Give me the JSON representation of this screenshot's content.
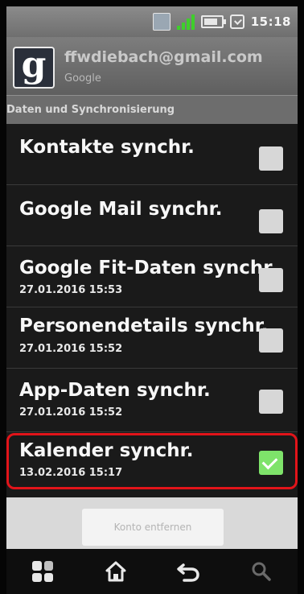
{
  "status_bar": {
    "time": "15:18",
    "icons": [
      "sim-icon",
      "signal-icon",
      "battery-icon",
      "alarm-icon"
    ],
    "signal_color": "#3ecf2b"
  },
  "account": {
    "logo_letter": "g",
    "email": "ffwdiebach@gmail.com",
    "provider": "Google"
  },
  "section_header": "Daten und Synchronisierung",
  "sync_items": [
    {
      "title": "Kontakte synchr.",
      "subtitle": "",
      "checked": false
    },
    {
      "title": "Google Mail synchr.",
      "subtitle": "",
      "checked": false
    },
    {
      "title": "Google Fit-Daten synchr.",
      "subtitle": "27.01.2016 15:53",
      "checked": false
    },
    {
      "title": "Personendetails synchr.",
      "subtitle": "27.01.2016 15:52",
      "checked": false
    },
    {
      "title": "App-Daten synchr.",
      "subtitle": "27.01.2016 15:52",
      "checked": false
    },
    {
      "title": "Kalender synchr.",
      "subtitle": "13.02.2016 15:17",
      "checked": true
    }
  ],
  "highlight_color": "#e2141a",
  "checkbox_checked_color": "#7ee36a",
  "remove_account_label": "Konto entfernen",
  "nav_bar": {
    "icons": [
      "apps-icon",
      "home-icon",
      "back-icon",
      "search-icon"
    ]
  }
}
